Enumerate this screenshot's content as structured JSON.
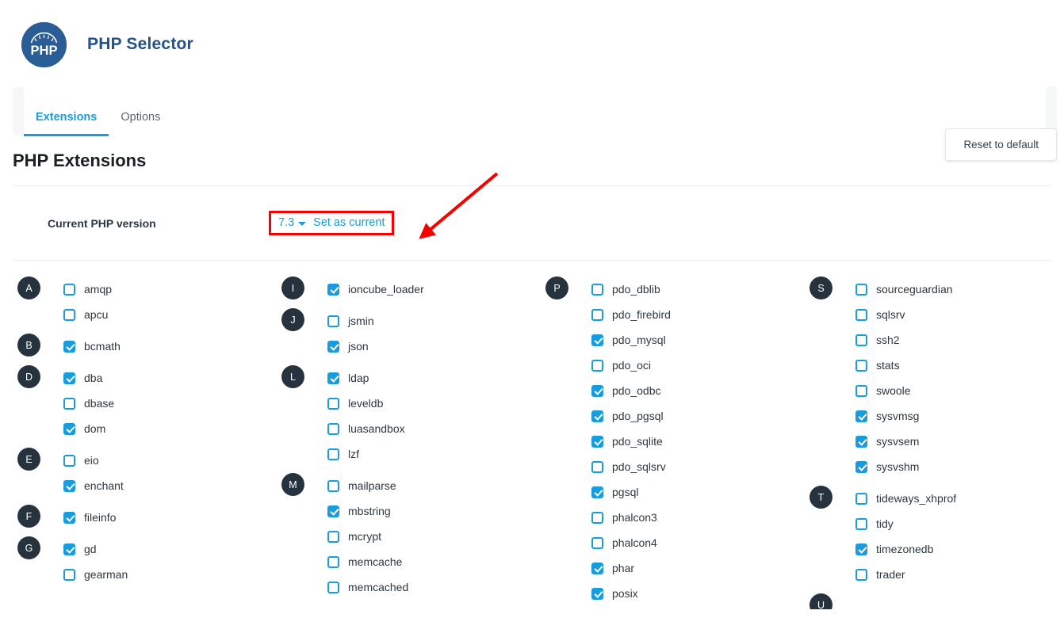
{
  "header": {
    "logo_text": "PHP",
    "title": "PHP Selector"
  },
  "tabs": [
    {
      "label": "Extensions",
      "active": true
    },
    {
      "label": "Options",
      "active": false
    }
  ],
  "section": {
    "title": "PHP Extensions",
    "reset_button": "Reset to default"
  },
  "version": {
    "label": "Current PHP version",
    "selected": "7.3",
    "set_current_link": "Set as current"
  },
  "colors": {
    "accent_blue": "#1a9bdc",
    "title_blue": "#22518c",
    "badge_dark": "#26323d",
    "annotation_red": "#f60000",
    "logo_blue": "#2a5d96"
  },
  "columns": [
    {
      "groups": [
        {
          "letter": "A",
          "items": [
            {
              "name": "amqp",
              "checked": false
            },
            {
              "name": "apcu",
              "checked": false
            }
          ]
        },
        {
          "letter": "B",
          "items": [
            {
              "name": "bcmath",
              "checked": true
            }
          ]
        },
        {
          "letter": "D",
          "items": [
            {
              "name": "dba",
              "checked": true
            },
            {
              "name": "dbase",
              "checked": false
            },
            {
              "name": "dom",
              "checked": true
            }
          ]
        },
        {
          "letter": "E",
          "items": [
            {
              "name": "eio",
              "checked": false
            },
            {
              "name": "enchant",
              "checked": true
            }
          ]
        },
        {
          "letter": "F",
          "items": [
            {
              "name": "fileinfo",
              "checked": true
            }
          ]
        },
        {
          "letter": "G",
          "items": [
            {
              "name": "gd",
              "checked": true
            },
            {
              "name": "gearman",
              "checked": false
            }
          ]
        }
      ]
    },
    {
      "groups": [
        {
          "letter": "I",
          "items": [
            {
              "name": "ioncube_loader",
              "checked": true
            }
          ]
        },
        {
          "letter": "J",
          "items": [
            {
              "name": "jsmin",
              "checked": false
            },
            {
              "name": "json",
              "checked": true
            }
          ]
        },
        {
          "letter": "L",
          "items": [
            {
              "name": "ldap",
              "checked": true
            },
            {
              "name": "leveldb",
              "checked": false
            },
            {
              "name": "luasandbox",
              "checked": false
            },
            {
              "name": "lzf",
              "checked": false
            }
          ]
        },
        {
          "letter": "M",
          "items": [
            {
              "name": "mailparse",
              "checked": false
            },
            {
              "name": "mbstring",
              "checked": true
            },
            {
              "name": "mcrypt",
              "checked": false
            },
            {
              "name": "memcache",
              "checked": false
            },
            {
              "name": "memcached",
              "checked": false
            }
          ]
        }
      ]
    },
    {
      "groups": [
        {
          "letter": "P",
          "items": [
            {
              "name": "pdo_dblib",
              "checked": false
            },
            {
              "name": "pdo_firebird",
              "checked": false
            },
            {
              "name": "pdo_mysql",
              "checked": true
            },
            {
              "name": "pdo_oci",
              "checked": false
            },
            {
              "name": "pdo_odbc",
              "checked": true
            },
            {
              "name": "pdo_pgsql",
              "checked": true
            },
            {
              "name": "pdo_sqlite",
              "checked": true
            },
            {
              "name": "pdo_sqlsrv",
              "checked": false
            },
            {
              "name": "pgsql",
              "checked": true
            },
            {
              "name": "phalcon3",
              "checked": false
            },
            {
              "name": "phalcon4",
              "checked": false
            },
            {
              "name": "phar",
              "checked": true
            },
            {
              "name": "posix",
              "checked": true
            }
          ]
        }
      ]
    },
    {
      "groups": [
        {
          "letter": "S",
          "items": [
            {
              "name": "sourceguardian",
              "checked": false
            },
            {
              "name": "sqlsrv",
              "checked": false
            },
            {
              "name": "ssh2",
              "checked": false
            },
            {
              "name": "stats",
              "checked": false
            },
            {
              "name": "swoole",
              "checked": false
            },
            {
              "name": "sysvmsg",
              "checked": true
            },
            {
              "name": "sysvsem",
              "checked": true
            },
            {
              "name": "sysvshm",
              "checked": true
            }
          ]
        },
        {
          "letter": "T",
          "items": [
            {
              "name": "tideways_xhprof",
              "checked": false
            },
            {
              "name": "tidy",
              "checked": false
            },
            {
              "name": "timezonedb",
              "checked": true
            },
            {
              "name": "trader",
              "checked": false
            }
          ]
        },
        {
          "letter": "U",
          "items": []
        }
      ]
    }
  ]
}
